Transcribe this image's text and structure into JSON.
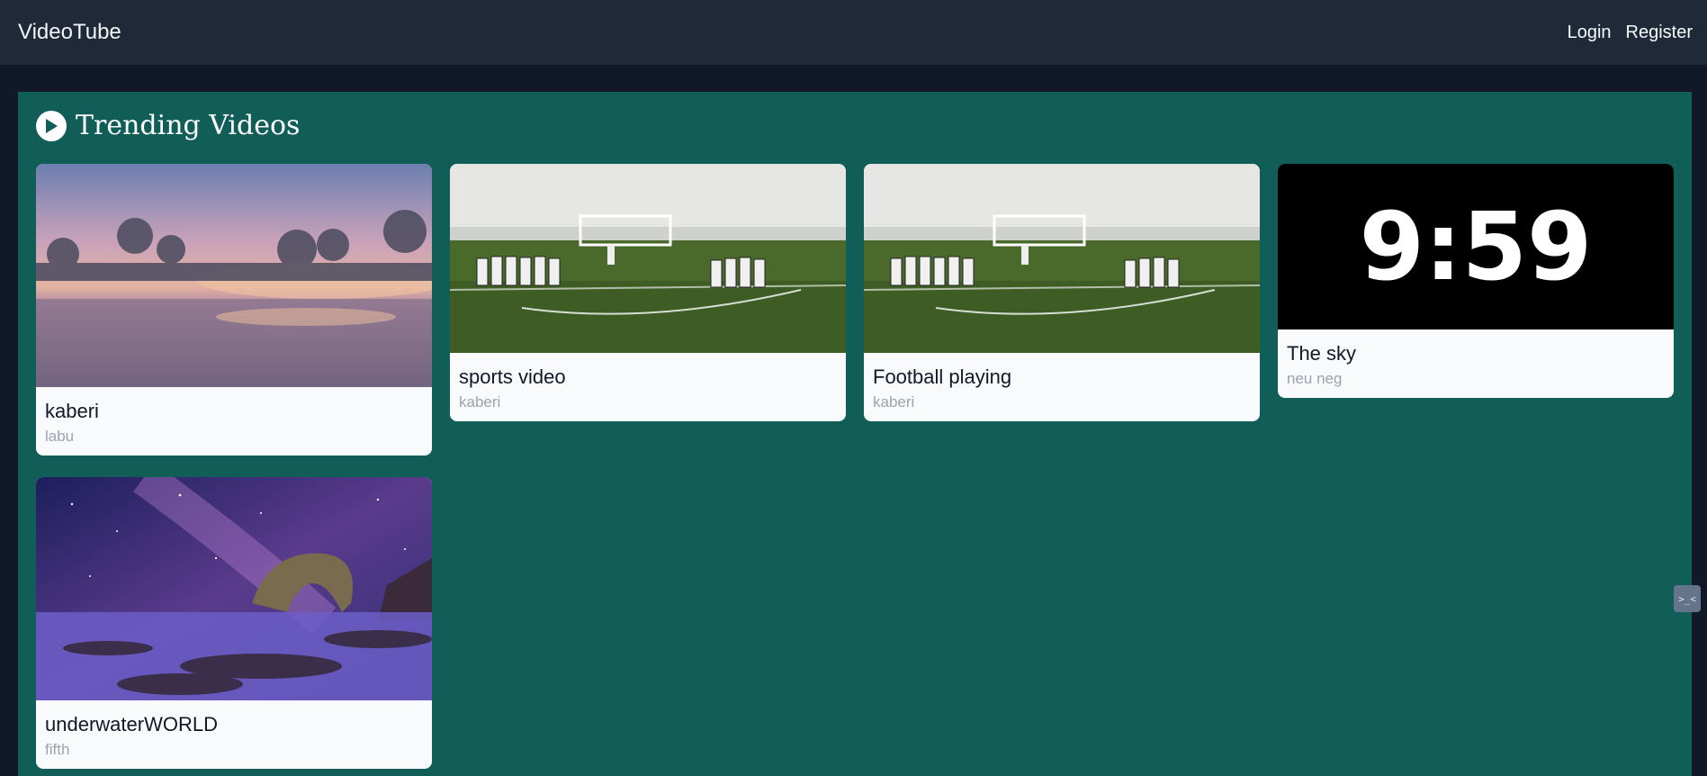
{
  "nav": {
    "brand": "VideoTube",
    "links": [
      "Login",
      "Register"
    ]
  },
  "section": {
    "title": "Trending Videos",
    "icon": "play-circle-icon"
  },
  "videos": [
    {
      "title": "kaberi",
      "author": "labu",
      "thumbnail": "misty-lake-sunrise"
    },
    {
      "title": "sports video",
      "author": "kaberi",
      "thumbnail": "football-field"
    },
    {
      "title": "Football playing",
      "author": "kaberi",
      "thumbnail": "football-field"
    },
    {
      "title": "The sky",
      "author": "neu neg",
      "thumbnail": "countdown-timer",
      "thumbnail_text": "9:59"
    },
    {
      "title": "underwaterWORLD",
      "author": "fifth",
      "thumbnail": "night-sky-rock-arch"
    }
  ],
  "side_tab": {
    "icon": "devtools-icon",
    "label": ">_<"
  },
  "colors": {
    "navbar": "#1f2937",
    "page_bg": "#111827",
    "panel": "#115e59",
    "card": "#f8fafc"
  }
}
